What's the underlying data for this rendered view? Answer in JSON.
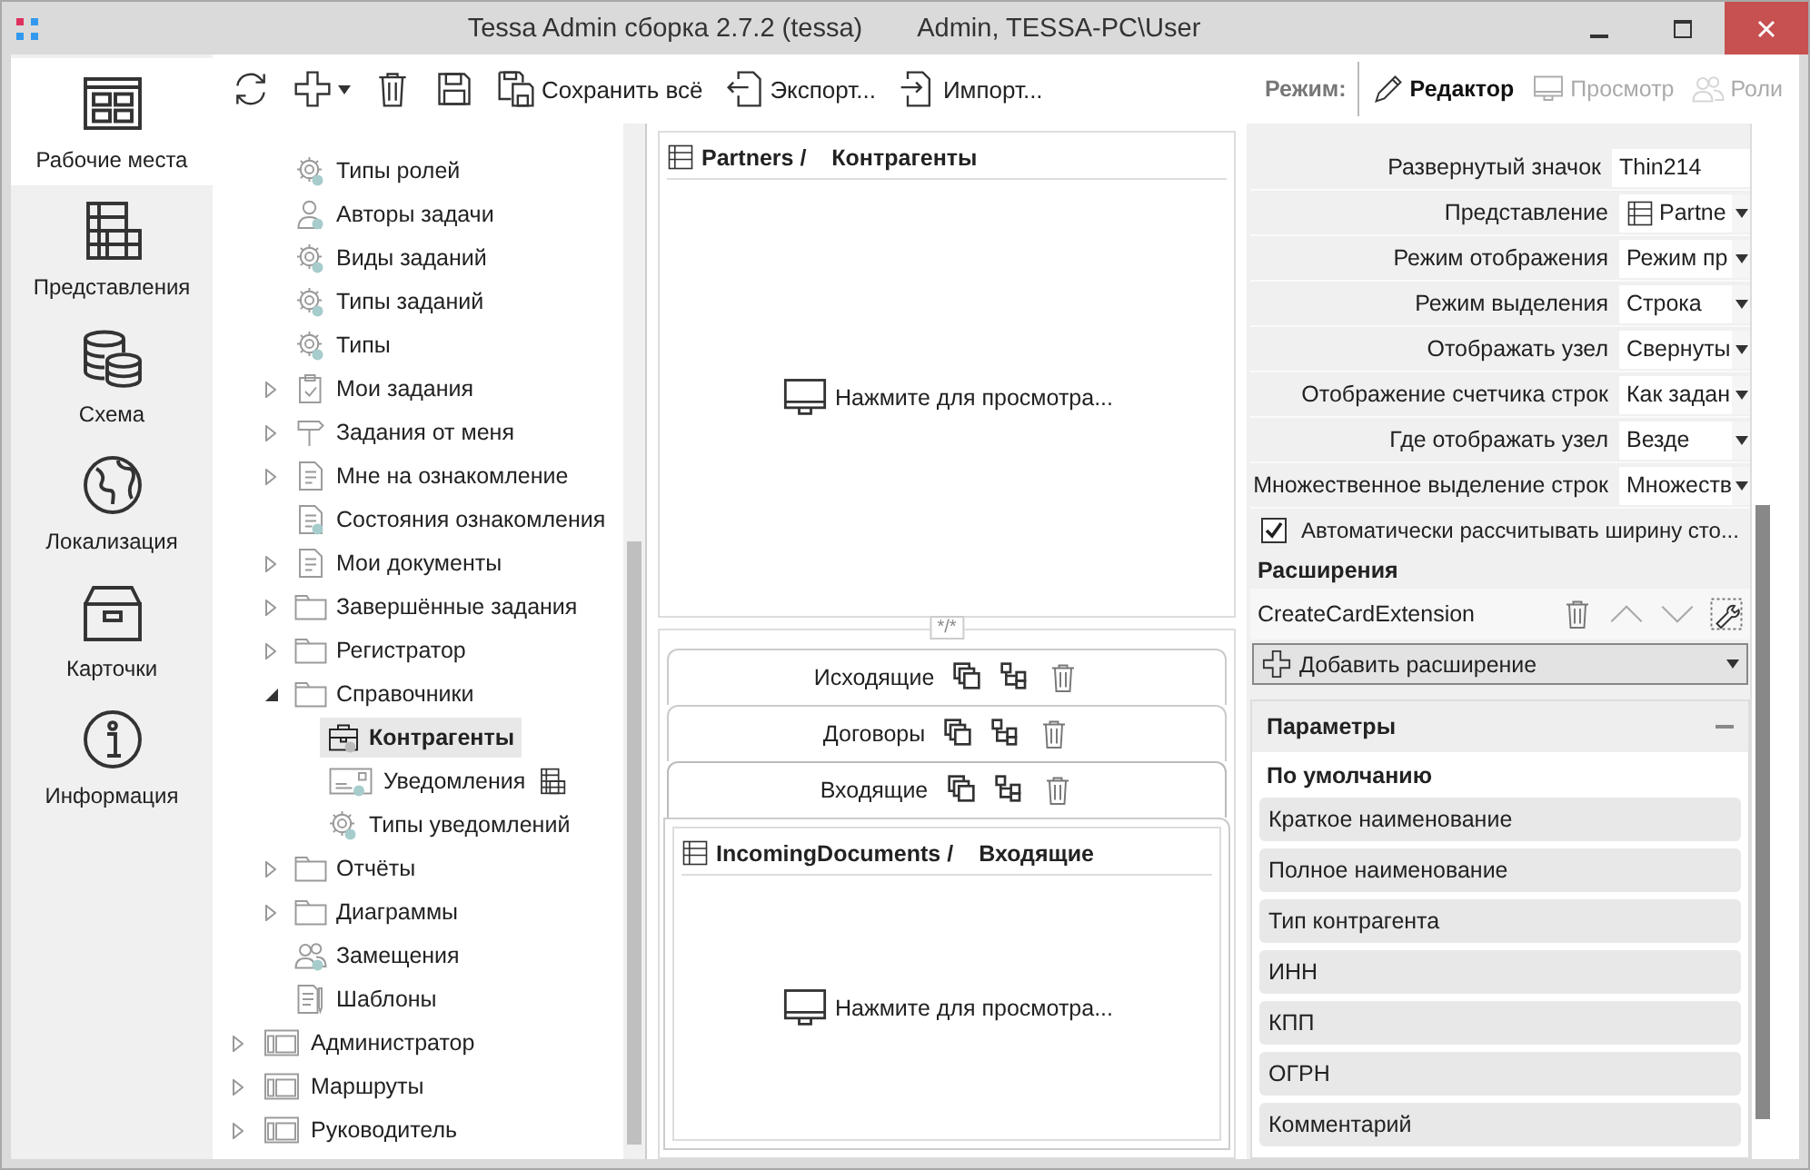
{
  "window": {
    "title": "Tessa Admin сборка 2.7.2 (tessa)",
    "user": "Admin, TESSA-PC\\User"
  },
  "nav": [
    {
      "label": "Рабочие места",
      "kind": "workspace",
      "selected": true
    },
    {
      "label": "Представления",
      "kind": "views",
      "selected": false
    },
    {
      "label": "Схема",
      "kind": "database",
      "selected": false
    },
    {
      "label": "Локализация",
      "kind": "globe",
      "selected": false
    },
    {
      "label": "Карточки",
      "kind": "box",
      "selected": false
    },
    {
      "label": "Информация",
      "kind": "info",
      "selected": false
    }
  ],
  "toolbar": {
    "buttons": [
      {
        "kind": "refresh"
      },
      {
        "kind": "add",
        "caret": true
      },
      {
        "kind": "delete"
      },
      {
        "kind": "save"
      },
      {
        "kind": "saveall",
        "label": "Сохранить всё"
      },
      {
        "kind": "export",
        "label": "Экспорт..."
      },
      {
        "kind": "import",
        "label": "Импорт..."
      }
    ],
    "mode_label": "Режим:",
    "modes": [
      {
        "label": "Редактор",
        "kind": "pencil",
        "selected": true
      },
      {
        "label": "Просмотр",
        "kind": "monitor",
        "selected": false
      },
      {
        "label": "Роли",
        "kind": "people",
        "selected": false
      }
    ]
  },
  "tree": {
    "partial_branch": [
      {
        "label": "Типы ролей",
        "kind": "gear",
        "badge": true,
        "selected": false
      },
      {
        "label": "Авторы задачи",
        "kind": "person",
        "badge": true,
        "selected": false
      },
      {
        "label": "Виды заданий",
        "kind": "gear",
        "badge": true,
        "selected": false
      },
      {
        "label": "Типы заданий",
        "kind": "gear",
        "badge": true,
        "selected": false
      },
      {
        "label": "Типы",
        "kind": "gear",
        "badge": true,
        "selected": false
      },
      {
        "label": "Мои задания",
        "kind": "clipboard",
        "badge": false,
        "expanded": false,
        "selected": false
      },
      {
        "label": "Задания от меня",
        "kind": "signpost",
        "badge": false,
        "expanded": false,
        "selected": false
      },
      {
        "label": "Мне на ознакомление",
        "kind": "document",
        "badge": false,
        "expanded": false,
        "selected": false
      },
      {
        "label": "Состояния ознакомления",
        "kind": "document",
        "badge": true,
        "selected": false
      },
      {
        "label": "Мои документы",
        "kind": "document",
        "badge": false,
        "expanded": false,
        "selected": false
      },
      {
        "label": "Завершённые задания",
        "kind": "folder",
        "badge": false,
        "expanded": false,
        "selected": false
      },
      {
        "label": "Регистратор",
        "kind": "folder",
        "badge": false,
        "expanded": false,
        "selected": false
      },
      {
        "label": "Справочники",
        "kind": "folder",
        "badge": false,
        "expanded": true,
        "selected": false,
        "children": [
          {
            "label": "Контрагенты",
            "kind": "briefcase",
            "badge": true,
            "selected": true
          },
          {
            "label": "Уведомления",
            "kind": "card",
            "badge": true,
            "view_icon": true,
            "selected": false
          },
          {
            "label": "Типы уведомлений",
            "kind": "gear",
            "badge": true,
            "selected": false
          }
        ]
      },
      {
        "label": "Отчёты",
        "kind": "folder",
        "badge": false,
        "expanded": false,
        "selected": false
      },
      {
        "label": "Диаграммы",
        "kind": "folder",
        "badge": false,
        "expanded": false,
        "selected": false
      },
      {
        "label": "Замещения",
        "kind": "people",
        "badge": true,
        "selected": false
      },
      {
        "label": "Шаблоны",
        "kind": "template",
        "badge": false,
        "selected": false
      }
    ],
    "items": [
      {
        "label": "Администратор",
        "kind": "window",
        "badge": false,
        "expanded": false,
        "selected": false
      },
      {
        "label": "Маршруты",
        "kind": "window",
        "badge": false,
        "expanded": false,
        "selected": false
      },
      {
        "label": "Руководитель",
        "kind": "window",
        "badge": false,
        "expanded": false,
        "selected": false
      }
    ]
  },
  "top_view": {
    "name": "Partners /",
    "caption": "Контрагенты",
    "placeholder": "Нажмите для просмотра..."
  },
  "tab_control": {
    "mask": "*/*",
    "tabs": [
      {
        "label": "Исходящие",
        "selected": false
      },
      {
        "label": "Договоры",
        "selected": false
      },
      {
        "label": "Входящие",
        "selected": true
      }
    ],
    "view": {
      "name": "IncomingDocuments /",
      "caption": "Входящие",
      "placeholder": "Нажмите для просмотра..."
    }
  },
  "properties": [
    {
      "label": "Развернутый значок",
      "value": "Thin214",
      "kind": "text"
    },
    {
      "label": "Представление",
      "value": "Partne",
      "kind": "viewdropdown"
    },
    {
      "label": "Режим отображения",
      "value": "Режим пр",
      "kind": "dropdown"
    },
    {
      "label": "Режим выделения",
      "value": "Строка",
      "kind": "dropdown"
    },
    {
      "label": "Отображать узел",
      "value": "Свернуты",
      "kind": "dropdown"
    },
    {
      "label": "Отображение счетчика строк",
      "value": "Как задан",
      "kind": "dropdown"
    },
    {
      "label": "Где отображать узел",
      "value": "Везде",
      "kind": "dropdown"
    },
    {
      "label": "Множественное выделение строк",
      "value": "Множеств",
      "kind": "dropdown"
    }
  ],
  "auto_width": {
    "label": "Автоматически рассчитывать ширину сто...",
    "checked": true
  },
  "extensions": {
    "title": "Расширения",
    "items": [
      "CreateCardExtension"
    ],
    "add_label": "Добавить расширение"
  },
  "parameters": {
    "title": "Параметры",
    "expanded": true,
    "group": "По умолчанию",
    "items": [
      "Краткое наименование",
      "Полное наименование",
      "Тип контрагента",
      "ИНН",
      "КПП",
      "ОГРН",
      "Комментарий"
    ]
  }
}
